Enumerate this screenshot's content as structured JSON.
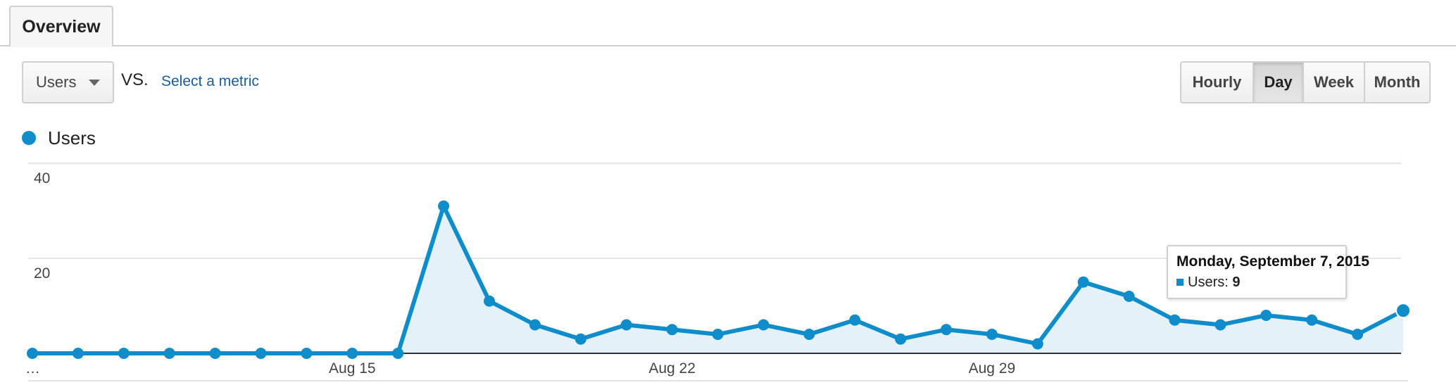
{
  "tabs": {
    "overview_label": "Overview"
  },
  "controls": {
    "metric_selected": "Users",
    "vs_label": "VS.",
    "select_metric_link": "Select a metric"
  },
  "granularity": {
    "options": [
      "Hourly",
      "Day",
      "Week",
      "Month"
    ],
    "active": "Day"
  },
  "legend": {
    "label": "Users"
  },
  "tooltip": {
    "date": "Monday, September 7, 2015",
    "metric_label": "Users:",
    "value": "9"
  },
  "colors": {
    "series": "#0f8dca",
    "area": "#e4f1f8"
  },
  "chart_data": {
    "type": "area",
    "series": [
      {
        "name": "Users",
        "values": [
          0,
          0,
          0,
          0,
          0,
          0,
          0,
          0,
          0,
          31,
          11,
          6,
          3,
          6,
          5,
          4,
          6,
          4,
          7,
          3,
          5,
          4,
          2,
          15,
          12,
          7,
          6,
          8,
          7,
          4,
          9
        ]
      }
    ],
    "x_tick_labels": [
      "…",
      "Aug 15",
      "Aug 22",
      "Aug 29"
    ],
    "y_ticks": [
      20,
      40
    ],
    "ylim": [
      0,
      40
    ],
    "grid": true
  }
}
